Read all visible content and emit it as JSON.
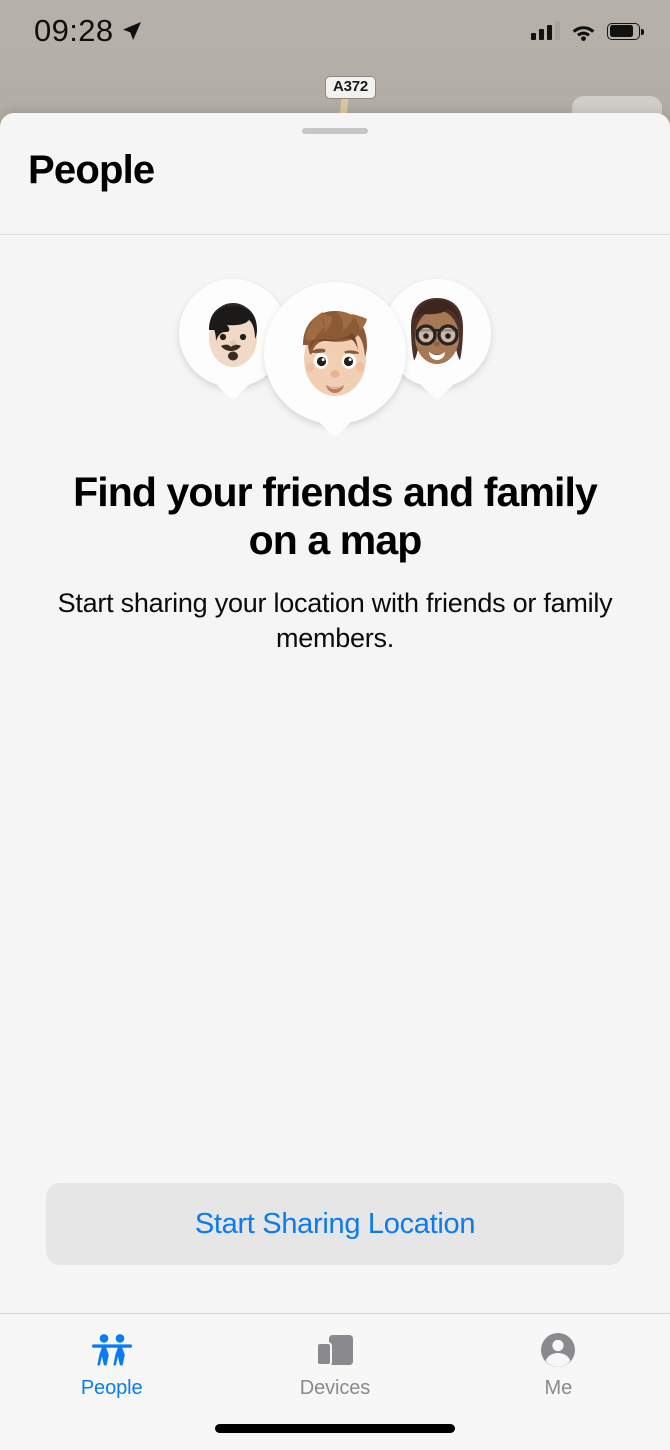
{
  "status_bar": {
    "time": "09:28",
    "location_arrow_icon": "location-arrow-icon",
    "cellular_icon": "cellular-signal-icon",
    "cellular_bars_filled": 3,
    "cellular_bars_total": 4,
    "wifi_icon": "wifi-icon",
    "battery_icon": "battery-icon",
    "battery_level_percent": 84
  },
  "map": {
    "road_shield_label": "A372",
    "road_shield_icon": "road-shield-icon",
    "map_control_icon": "map-control-button",
    "background_color": "#b5b0a8",
    "road_color": "#ddc79a"
  },
  "sheet": {
    "grabber_icon": "sheet-grabber-handle",
    "title": "People"
  },
  "empty_state": {
    "avatars": [
      {
        "name": "memoji-avatar-left",
        "description": "black bowl-cut hair with mustache and goatee"
      },
      {
        "name": "memoji-avatar-center",
        "description": "brown spiky hair light skin"
      },
      {
        "name": "memoji-avatar-right",
        "description": "long brown hair with bangs and round glasses"
      }
    ],
    "headline": "Find your friends and family on a map",
    "subtitle": "Start sharing your location with friends or family members."
  },
  "action": {
    "start_sharing_label": "Start Sharing Location",
    "accent_color": "#0a7cf0",
    "button_background": "#e6e6e6"
  },
  "tab_bar": {
    "active_color": "#0a7cf0",
    "inactive_color": "#8a8a8e",
    "tabs": [
      {
        "label": "People",
        "icon": "people-icon",
        "active": true
      },
      {
        "label": "Devices",
        "icon": "devices-icon",
        "active": false
      },
      {
        "label": "Me",
        "icon": "person-circle-icon",
        "active": false
      }
    ]
  },
  "home_indicator_icon": "home-indicator"
}
